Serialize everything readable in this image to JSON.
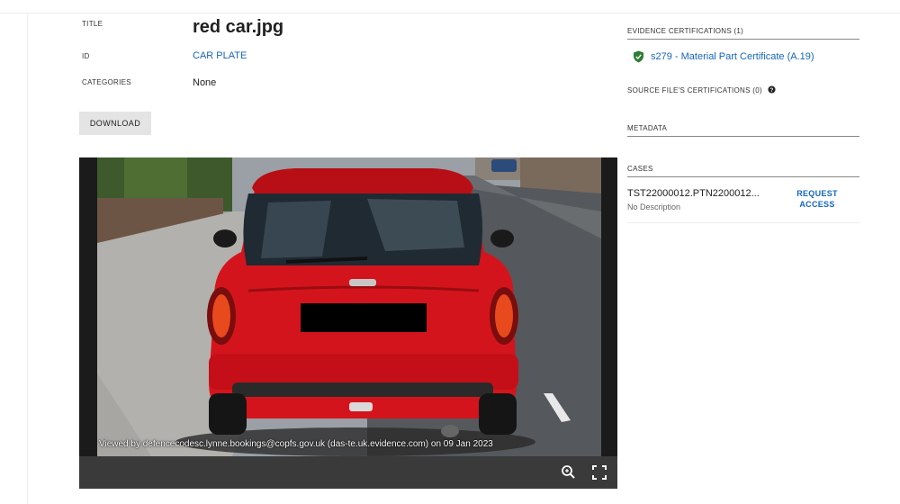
{
  "details": {
    "title_label": "TITLE",
    "title_value": "red car.jpg",
    "id_label": "ID",
    "id_value": "CAR PLATE",
    "categories_label": "CATEGORIES",
    "categories_value": "None"
  },
  "actions": {
    "download_label": "DOWNLOAD"
  },
  "viewer": {
    "watermark": "Viewed by defencecodesc.lynne.bookings@copfs.gov.uk (das-te.uk.evidence.com) on 09 Jan 2023",
    "zoom_icon": "zoom-in-icon",
    "fullscreen_icon": "fullscreen-icon"
  },
  "sidebar": {
    "evidence_certifications_label": "EVIDENCE CERTIFICATIONS (1)",
    "certification": "s279 - Material Part Certificate (A.19)",
    "certification_icon": "shield-check-icon",
    "source_certifications_label": "SOURCE FILE'S CERTIFICATIONS (0)",
    "help_icon": "help-icon",
    "metadata_label": "METADATA",
    "cases_label": "CASES",
    "case_id": "TST22000012.PTN2200012...",
    "case_description": "No Description",
    "request_access_label": "REQUEST ACCESS"
  },
  "colors": {
    "link": "#1565c0",
    "certification_shield": "#2e7d32",
    "car_body": "#d4141c",
    "viewer_bar": "#3a3a3a"
  }
}
